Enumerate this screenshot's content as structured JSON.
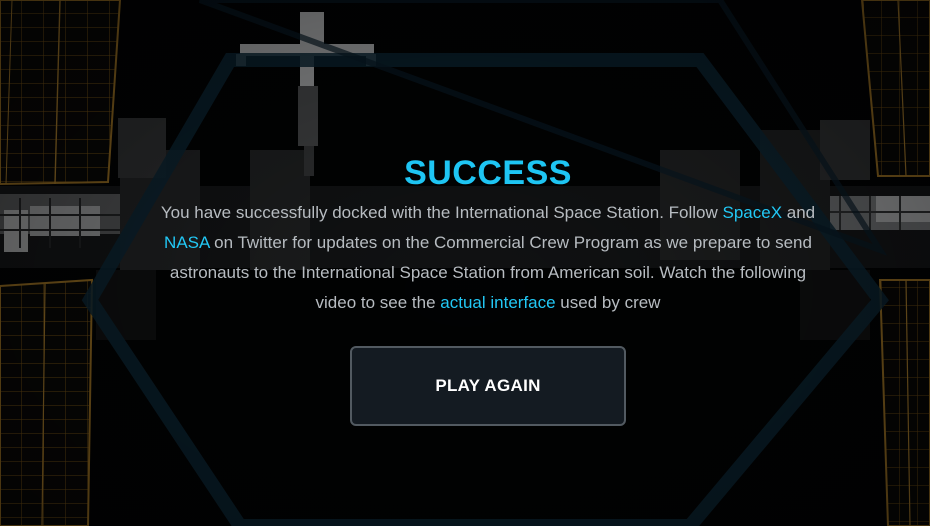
{
  "title": "SUCCESS",
  "message": {
    "part1": "You have successfully docked with the International Space Station. Follow ",
    "link_spacex": "SpaceX",
    "part2": " and ",
    "link_nasa": "NASA",
    "part3": " on Twitter for updates on the Commercial Crew Program as we prepare to send astronauts to the International Space Station from American soil. Watch the following video to see the ",
    "link_interface": "actual interface",
    "part4": " used by crew"
  },
  "button": {
    "label": "PLAY AGAIN"
  },
  "colors": {
    "accent": "#1ec5f3",
    "text": "#b7bcc1",
    "button_bg": "#141b22",
    "button_border": "#525a61",
    "hexagon": "#0d2a3a",
    "solar_panel_line": "#b8862a"
  },
  "icons": [
    "iss-station-illustration",
    "hexagon-outline"
  ]
}
